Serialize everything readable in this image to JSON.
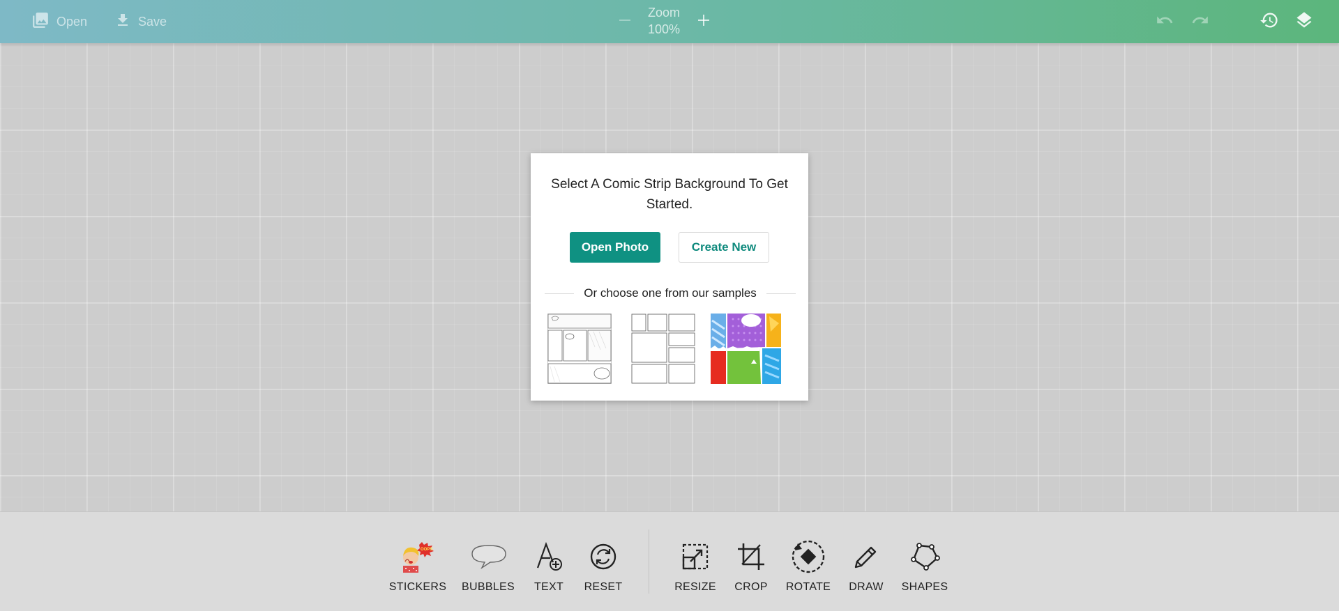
{
  "topbar": {
    "open_label": "Open",
    "save_label": "Save",
    "zoom_label": "Zoom",
    "zoom_value": "100%",
    "icons": [
      "image-icon",
      "download-icon",
      "minus-icon",
      "plus-icon",
      "undo-icon",
      "redo-icon",
      "history-icon",
      "layers-icon"
    ]
  },
  "dialog": {
    "title": "Select A Comic Strip Background To Get Started.",
    "open_photo_label": "Open Photo",
    "create_new_label": "Create New",
    "samples_caption": "Or choose one from our samples"
  },
  "toolbar": {
    "tools": [
      {
        "label": "STICKERS",
        "icon": "sticker-icon"
      },
      {
        "label": "BUBBLES",
        "icon": "speech-bubble-icon"
      },
      {
        "label": "TEXT",
        "icon": "text-add-icon"
      },
      {
        "label": "RESET",
        "icon": "reset-icon"
      },
      {
        "label": "RESIZE",
        "icon": "resize-icon"
      },
      {
        "label": "CROP",
        "icon": "crop-icon"
      },
      {
        "label": "ROTATE",
        "icon": "rotate-icon"
      },
      {
        "label": "DRAW",
        "icon": "pencil-icon"
      },
      {
        "label": "SHAPES",
        "icon": "pentagon-icon"
      }
    ]
  },
  "colors": {
    "accent": "#0f9182",
    "topbar_start": "#7eb9c6",
    "topbar_end": "#5cb67c"
  }
}
